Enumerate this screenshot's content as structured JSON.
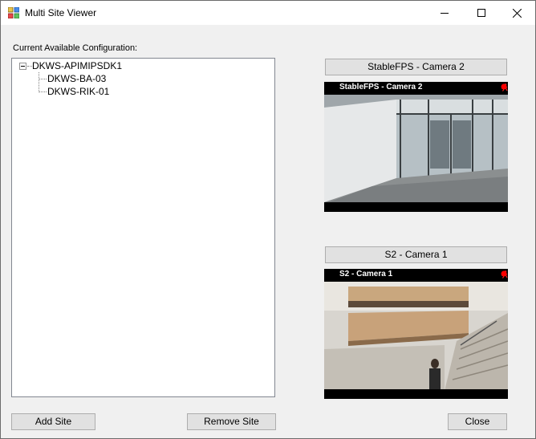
{
  "window": {
    "title": "Multi Site Viewer",
    "controls": {
      "minimize": "minimize-icon",
      "maximize": "maximize-icon",
      "close": "close-icon"
    }
  },
  "config_label": "Current Available Configuration:",
  "tree": {
    "root": "DKWS-APIMIPSDK1",
    "children": [
      "DKWS-BA-03",
      "DKWS-RIK-01"
    ]
  },
  "cameras": [
    {
      "header": "StableFPS - Camera 2",
      "overlay_title": "StableFPS - Camera 2"
    },
    {
      "header": "S2 - Camera 1",
      "overlay_title": "S2 - Camera 1"
    }
  ],
  "buttons": {
    "add_site": "Add Site",
    "remove_site": "Remove Site",
    "close": "Close"
  },
  "colors": {
    "recording": "#ff0000",
    "motion": "#ff2020",
    "overlay_bg": "#000000"
  }
}
